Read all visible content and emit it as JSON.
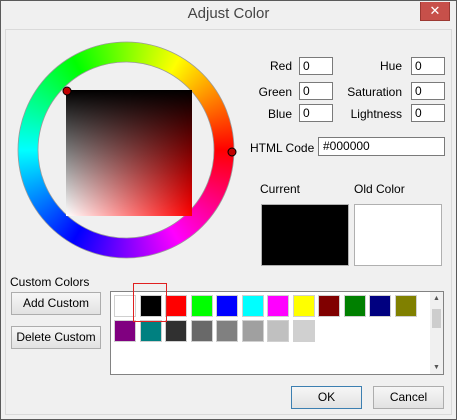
{
  "window": {
    "title": "Adjust Color",
    "close_glyph": "✕"
  },
  "rgb": {
    "red_label": "Red",
    "red_value": "0",
    "green_label": "Green",
    "green_value": "0",
    "blue_label": "Blue",
    "blue_value": "0"
  },
  "hsl": {
    "hue_label": "Hue",
    "hue_value": "0",
    "saturation_label": "Saturation",
    "saturation_value": "0",
    "lightness_label": "Lightness",
    "lightness_value": "0"
  },
  "html_code": {
    "label": "HTML Code",
    "value": "#000000"
  },
  "preview": {
    "current_label": "Current",
    "current_color": "#000000",
    "old_label": "Old Color",
    "old_color": "#ffffff"
  },
  "custom": {
    "label": "Custom Colors",
    "add_button": "Add Custom",
    "delete_button": "Delete Custom",
    "selected_index": 1,
    "swatches": [
      "#ffffff",
      "#000000",
      "#ff0000",
      "#00ff00",
      "#0000ff",
      "#00ffff",
      "#ff00ff",
      "#ffff00",
      "#800000",
      "#008000",
      "#000080",
      "#808000",
      "#800080",
      "#008080",
      "#303030",
      "#696969",
      "#808080",
      "#a0a0a0",
      "#c0c0c0",
      "#d0d0d0"
    ]
  },
  "icons": {
    "close": "close-icon",
    "scroll_up": "scroll-up-icon",
    "scroll_down": "scroll-down-icon",
    "hue_knob": "hue-knob-icon",
    "sv_knob": "sv-knob-icon"
  },
  "buttons": {
    "ok": "OK",
    "cancel": "Cancel"
  }
}
